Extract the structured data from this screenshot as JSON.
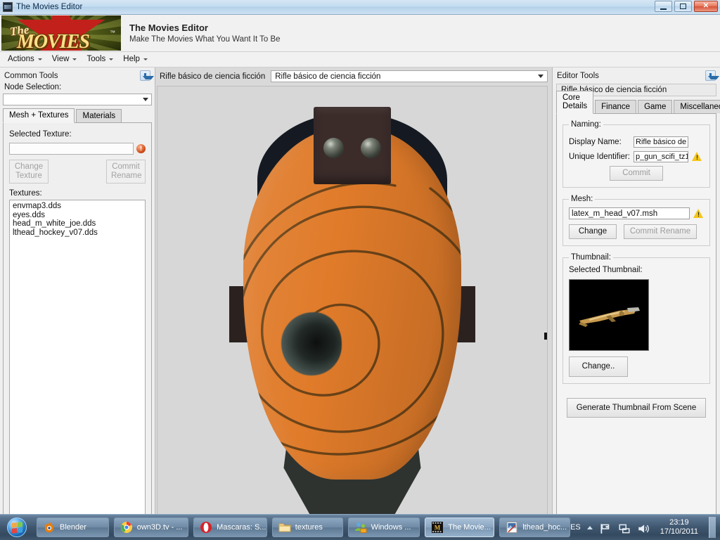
{
  "window": {
    "title": "The Movies Editor",
    "icon": "app-film-icon",
    "minimize_label": "Minimize",
    "maximize_label": "Maximize",
    "close_label": "Close"
  },
  "brand": {
    "logo_the": "The",
    "logo_movies": "MOVIES",
    "logo_tm": "™",
    "heading": "The Movies Editor",
    "subheading": "Make The Movies What You Want It To Be"
  },
  "menu": {
    "items": [
      {
        "label": "Actions"
      },
      {
        "label": "View"
      },
      {
        "label": "Tools"
      },
      {
        "label": "Help"
      }
    ]
  },
  "left_panel": {
    "title": "Common Tools",
    "pin_icon": "auto-hide-pin-icon",
    "node_selection_label": "Node Selection:",
    "node_selection_value": "",
    "tabs": [
      {
        "label": "Mesh + Textures",
        "active": true
      },
      {
        "label": "Materials",
        "active": false
      }
    ],
    "selected_texture_label": "Selected Texture:",
    "selected_texture_value": "",
    "error_badge": "!",
    "change_texture_label": "Change Texture",
    "commit_rename_label": "Commit Rename",
    "textures_label": "Textures:",
    "textures": [
      "envmap3.dds",
      "eyes.dds",
      "head_m_white_joe.dds",
      "lthead_hockey_v07.dds"
    ]
  },
  "center": {
    "object_name": "Rifle básico de ciencia ficción",
    "object_combo_value": "Rifle básico de ciencia ficción",
    "viewport_name": "3d-model-viewport",
    "viewport_bg": "#d7d7d7",
    "model_colors": {
      "mask_orange": "#e07b2a",
      "spiral_line": "#6b4318",
      "hair_dark": "#151a22",
      "neck_dark": "#2e3330",
      "goggle_brown": "#3b2c2a"
    }
  },
  "right_panel": {
    "title": "Editor Tools",
    "pin_icon": "auto-hide-pin-icon",
    "object_name": "Rifle básico de ciencia ficción",
    "tabs": [
      {
        "label": "Core Details",
        "active": true
      },
      {
        "label": "Finance",
        "active": false
      },
      {
        "label": "Game",
        "active": false
      },
      {
        "label": "Miscellaneous",
        "active": false
      }
    ],
    "naming": {
      "legend": "Naming:",
      "display_name_label": "Display Name:",
      "display_name_value": "Rifle básico de cie",
      "unique_identifier_label": "Unique Identifier:",
      "unique_identifier_value": "p_gun_scifi_tz1",
      "unique_identifier_warning": "warning-icon",
      "commit_label": "Commit"
    },
    "mesh": {
      "legend": "Mesh:",
      "value": "latex_m_head_v07.msh",
      "warning": "warning-icon",
      "change_label": "Change",
      "commit_rename_label": "Commit Rename"
    },
    "thumbnail": {
      "legend": "Thumbnail:",
      "selected_label": "Selected Thumbnail:",
      "image_alt": "sci-fi-rifle-thumbnail",
      "change_label": "Change.."
    },
    "generate_thumbnail_label": "Generate Thumbnail  From Scene"
  },
  "taskbar": {
    "start_label": "Start",
    "buttons": [
      {
        "label": "Blender",
        "icon": "blender-icon",
        "active": false
      },
      {
        "label": "own3D.tv - ...",
        "icon": "chrome-icon",
        "active": false
      },
      {
        "label": "Mascaras: S...",
        "icon": "opera-icon",
        "active": false
      },
      {
        "label": "textures",
        "icon": "folder-icon",
        "active": false
      },
      {
        "label": "Windows ...",
        "icon": "windows-live-icon",
        "active": false
      },
      {
        "label": "The Movie...",
        "icon": "movies-film-icon",
        "active": true
      },
      {
        "label": "lthead_hoc...",
        "icon": "image-editor-icon",
        "active": false
      }
    ],
    "tray": {
      "language": "ES",
      "show_hidden_icons": "show-hidden-icons-arrow",
      "icons": [
        "network-flag-icon",
        "network-icon",
        "volume-icon"
      ],
      "time": "23:19",
      "date": "17/10/2011"
    }
  }
}
